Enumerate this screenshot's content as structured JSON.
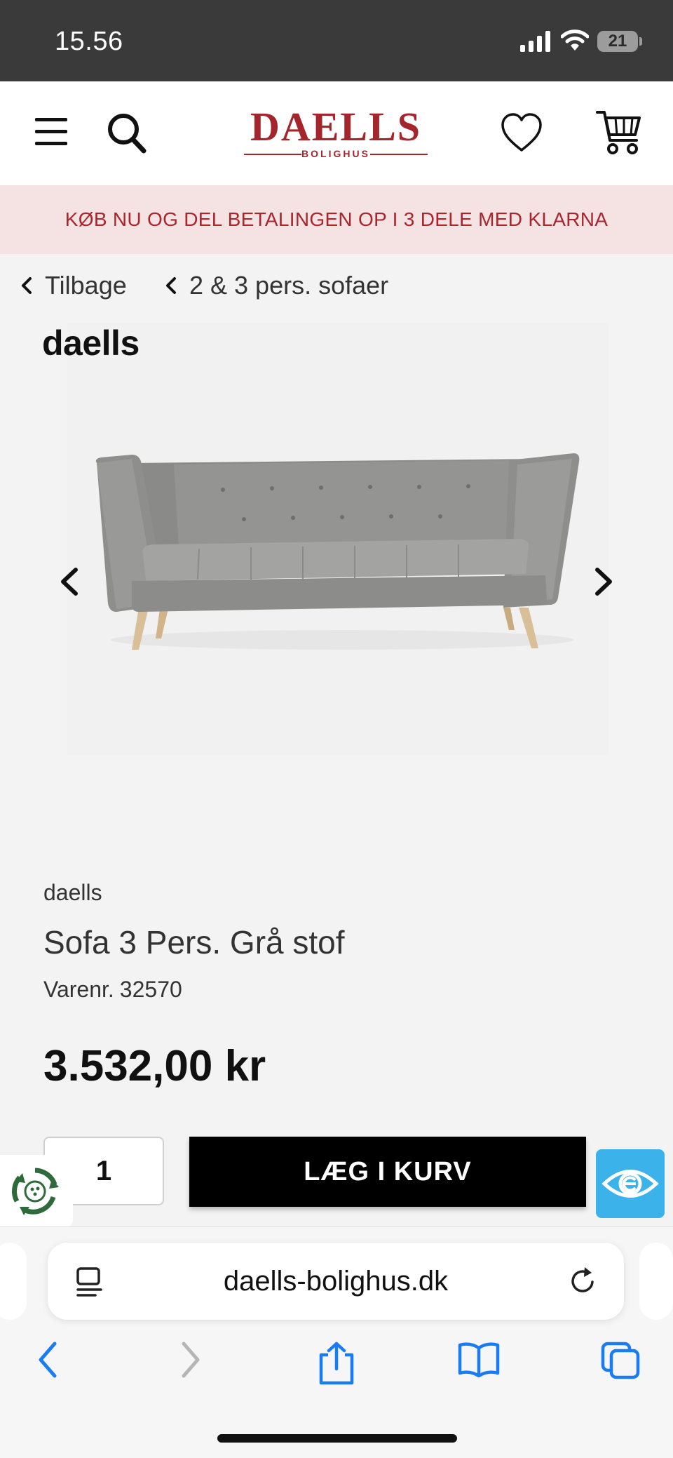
{
  "status_bar": {
    "time": "15.56",
    "battery": "21"
  },
  "header": {
    "logo_brand": "DAELLS",
    "logo_sub": "BOLIGHUS"
  },
  "promo": {
    "text": "KØB NU OG DEL BETALINGEN OP I 3 DELE MED KLARNA"
  },
  "breadcrumbs": {
    "back_label": "Tilbage",
    "category_label": "2 & 3 pers. sofaer"
  },
  "gallery": {
    "brand_mark": "daells"
  },
  "product": {
    "brand": "daells",
    "title": "Sofa 3 Pers. Grå stof",
    "sku_label": "Varenr.",
    "sku": "32570",
    "price": "3.532,00 kr",
    "quantity": "1",
    "add_to_cart_label": "LÆG I KURV"
  },
  "browser": {
    "url": "daells-bolighus.dk"
  },
  "colors": {
    "brand_red": "#a4262c",
    "promo_bg": "#f5e3e4",
    "cta_bg": "#000000",
    "eye_badge": "#3bb3ea",
    "safari_blue": "#1a7cf5"
  }
}
